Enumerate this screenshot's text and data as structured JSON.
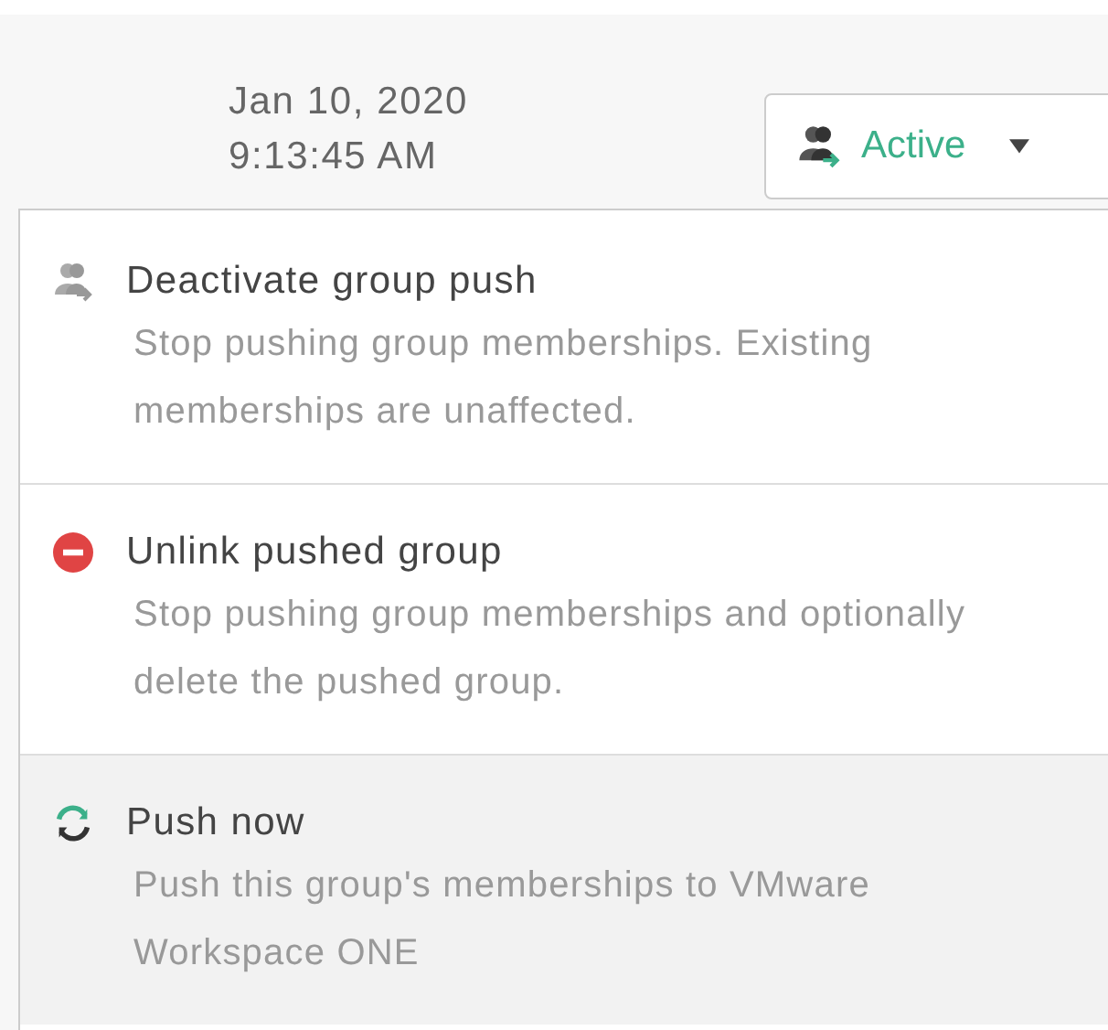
{
  "timestamp": {
    "date": "Jan 10, 2020",
    "time": "9:13:45 AM"
  },
  "status_button": {
    "label": "Active"
  },
  "menu": [
    {
      "kind": "deactivate",
      "title": "Deactivate group push",
      "description": "Stop pushing group memberships. Existing memberships are unaffected.",
      "selected": false
    },
    {
      "kind": "unlink",
      "title": "Unlink pushed group",
      "description": "Stop pushing group memberships and optionally delete the pushed group.",
      "selected": false
    },
    {
      "kind": "sync",
      "title": "Push now",
      "description": "Push this group's memberships to VMware Workspace ONE",
      "selected": true
    }
  ]
}
